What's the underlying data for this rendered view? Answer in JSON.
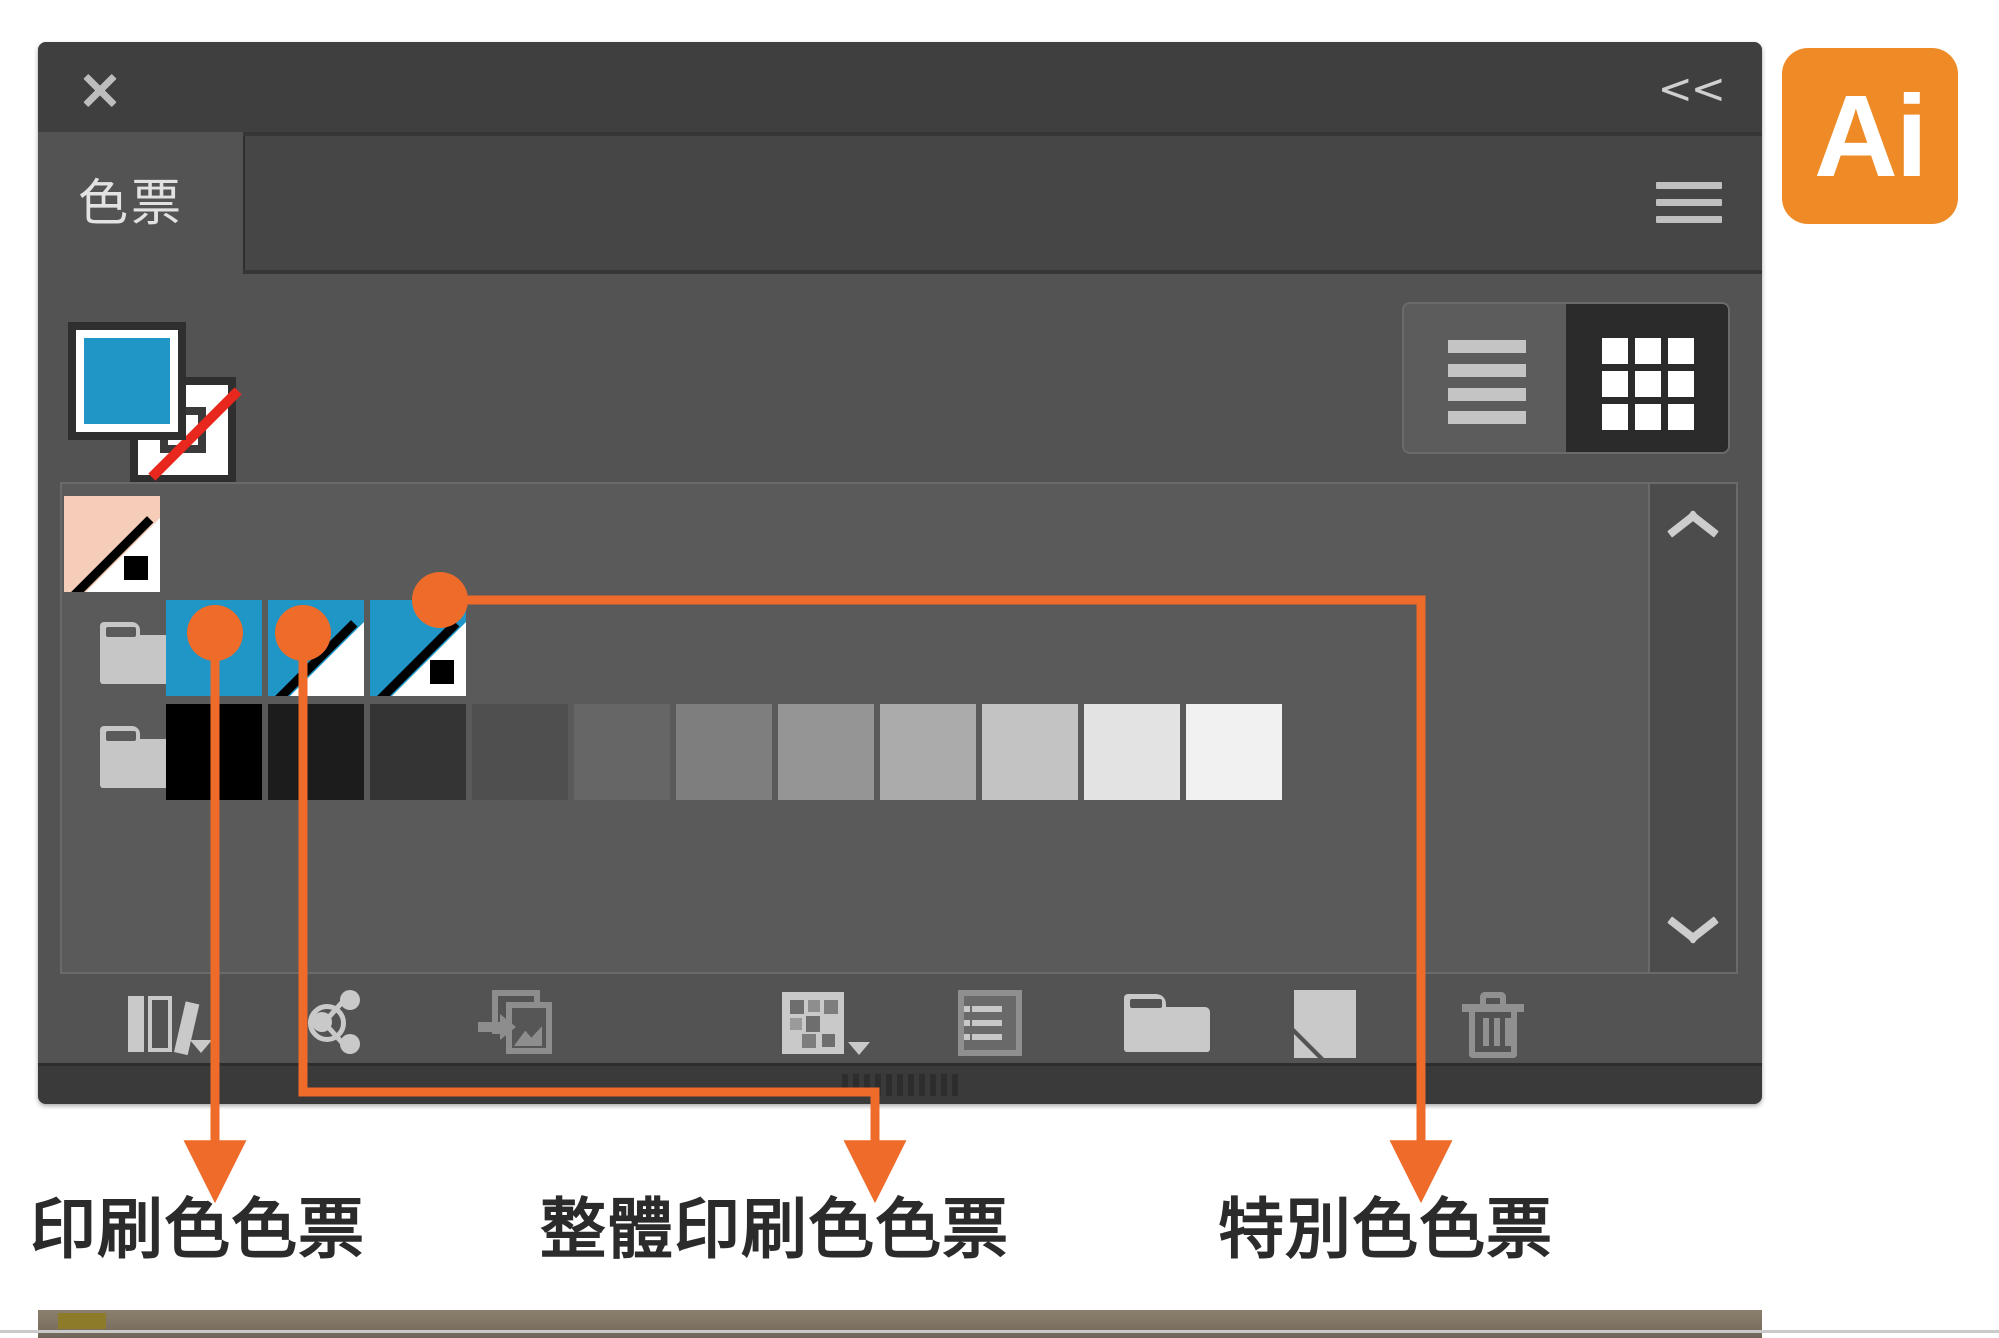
{
  "app": {
    "logo_label": "Ai",
    "logo_color": "#ef8b27"
  },
  "panel": {
    "title": "色票",
    "close_icon": "close-icon",
    "collapse_label": "<<",
    "menu_icon": "hamburger-menu-icon"
  },
  "fill_stroke": {
    "fill_color": "#1f96c6",
    "stroke_color": "none",
    "stroke_none_indicator_color": "#e8281e"
  },
  "view_toggles": {
    "list_view_label": "list-view",
    "grid_view_label": "grid-view",
    "active": "grid-view"
  },
  "swatches": {
    "rows": [
      {
        "items": [
          {
            "kind": "spot",
            "color": "#f6cdb8",
            "marker": "dot"
          }
        ]
      },
      {
        "items": [
          {
            "kind": "group",
            "color": "#c6c6c6",
            "marker": "folder"
          },
          {
            "kind": "process",
            "color": "#1f96c6",
            "marker": "none"
          },
          {
            "kind": "global-process",
            "color": "#1f96c6",
            "marker": "diagonal"
          },
          {
            "kind": "spot",
            "color": "#1f96c6",
            "marker": "dot"
          }
        ]
      },
      {
        "items": [
          {
            "kind": "group",
            "color": "#c6c6c6",
            "marker": "folder"
          },
          {
            "kind": "process",
            "color": "#000000",
            "marker": "none"
          },
          {
            "kind": "process",
            "color": "#1c1c1c",
            "marker": "none"
          },
          {
            "kind": "process",
            "color": "#343434",
            "marker": "none"
          },
          {
            "kind": "process",
            "color": "#4f4f4f",
            "marker": "none"
          },
          {
            "kind": "process",
            "color": "#666666",
            "marker": "none"
          },
          {
            "kind": "process",
            "color": "#7e7e7e",
            "marker": "none"
          },
          {
            "kind": "process",
            "color": "#959595",
            "marker": "none"
          },
          {
            "kind": "process",
            "color": "#ababab",
            "marker": "none"
          },
          {
            "kind": "process",
            "color": "#c3c3c3",
            "marker": "none"
          },
          {
            "kind": "process",
            "color": "#e3e3e3",
            "marker": "none"
          },
          {
            "kind": "process",
            "color": "#f1f1f1",
            "marker": "none"
          }
        ]
      }
    ],
    "scroll_up_icon": "chevron-up-icon",
    "scroll_down_icon": "chevron-down-icon"
  },
  "toolbar": {
    "items": [
      {
        "name": "swatch-libraries-menu",
        "icon": "books-icon",
        "enabled": true
      },
      {
        "name": "show-color-group-colors",
        "icon": "color-link-icon",
        "enabled": true
      },
      {
        "name": "add-selected-to-library",
        "icon": "add-to-library-icon",
        "enabled": false
      },
      {
        "name": "show-swatch-kinds-menu",
        "icon": "swatch-kinds-icon",
        "enabled": true
      },
      {
        "name": "swatch-options",
        "icon": "swatch-options-icon",
        "enabled": true
      },
      {
        "name": "new-color-group",
        "icon": "folder-icon",
        "enabled": true
      },
      {
        "name": "new-swatch",
        "icon": "new-page-icon",
        "enabled": true
      },
      {
        "name": "delete-swatch",
        "icon": "trash-icon",
        "enabled": false
      }
    ]
  },
  "annotations": {
    "accent_color": "#ef6b29",
    "callouts": [
      {
        "id": "process",
        "label": "印刷色色票"
      },
      {
        "id": "global",
        "label": "整體印刷色色票"
      },
      {
        "id": "spot",
        "label": "特別色色票"
      }
    ]
  }
}
